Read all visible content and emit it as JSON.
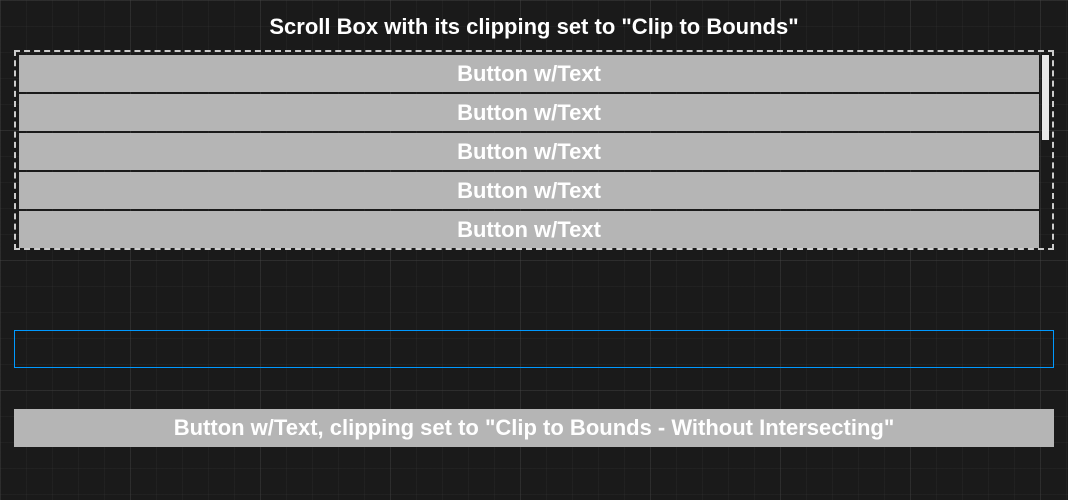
{
  "title": "Scroll Box with its clipping set to \"Clip to Bounds\"",
  "scrollbox": {
    "buttons": [
      {
        "label": "Button w/Text"
      },
      {
        "label": "Button w/Text"
      },
      {
        "label": "Button w/Text"
      },
      {
        "label": "Button w/Text"
      },
      {
        "label": "Button w/Text"
      }
    ]
  },
  "bottom_button": {
    "label": "Button w/Text, clipping set to \"Clip to Bounds - Without Intersecting\""
  }
}
